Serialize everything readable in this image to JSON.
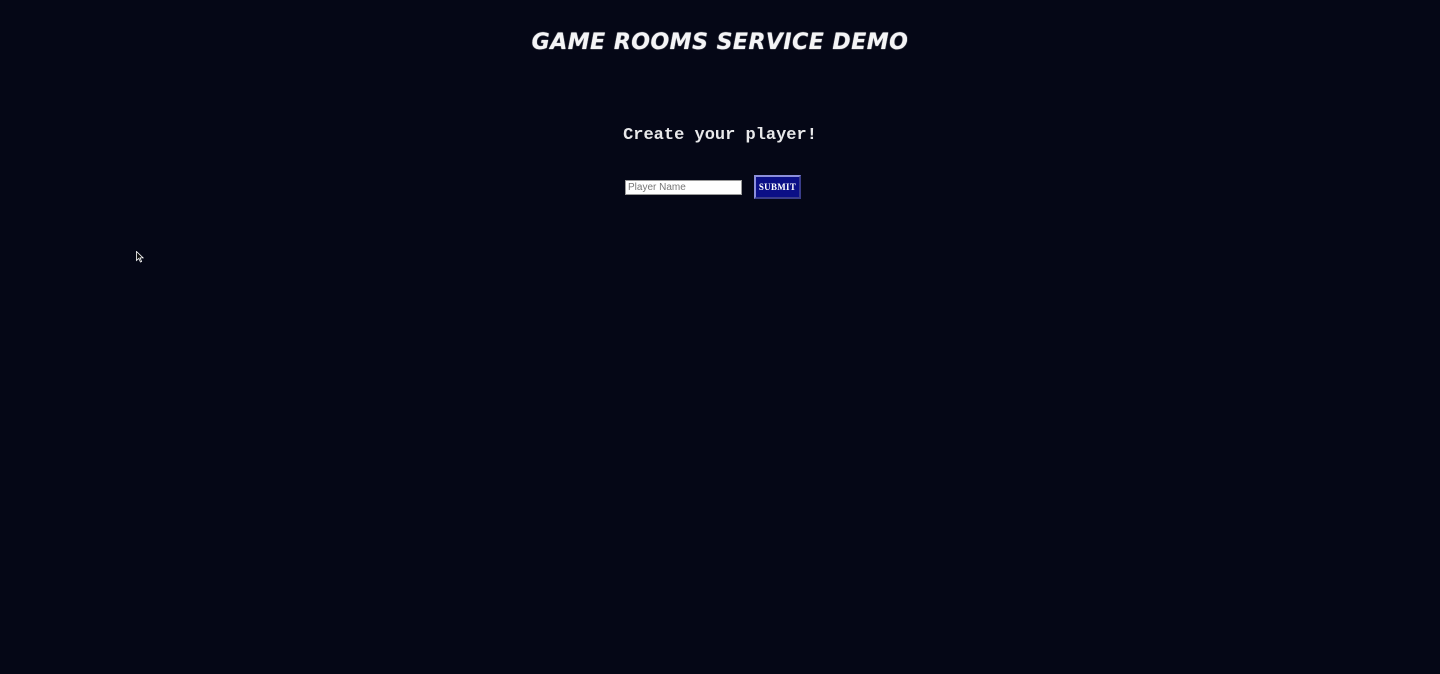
{
  "header": {
    "title": "GAME ROOMS SERVICE DEMO"
  },
  "main": {
    "heading": "Create your player!",
    "player_name": {
      "placeholder": "Player Name",
      "value": ""
    },
    "submit_label": "SUBMIT"
  },
  "colors": {
    "background": "#050716",
    "button": "#0b0f86"
  },
  "icons": {
    "cursor": "mouse-pointer-icon"
  }
}
